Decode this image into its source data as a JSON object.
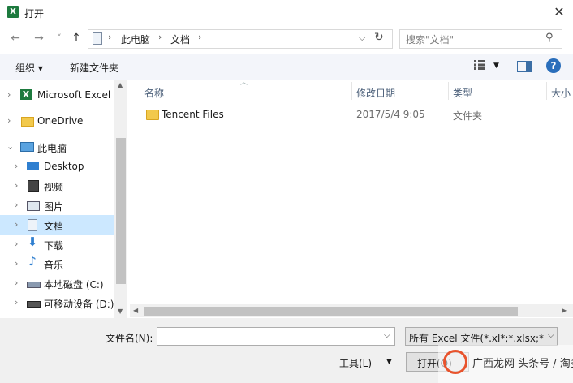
{
  "window": {
    "title": "打开",
    "app_icon": "excel-icon",
    "close_glyph": "✕"
  },
  "nav": {
    "back_glyph": "←",
    "forward_glyph": "→",
    "recent_glyph": "˅",
    "up_glyph": "↑",
    "breadcrumb": [
      "此电脑",
      "文档"
    ],
    "search_placeholder": "搜索\"文档\""
  },
  "toolbar": {
    "organize": "组织 ▾",
    "new_folder": "新建文件夹",
    "help": "?"
  },
  "tree": [
    {
      "label": "Microsoft Excel",
      "icon": "excel-icon",
      "chev": "›"
    },
    {
      "label": "OneDrive",
      "icon": "folder-icon",
      "chev": "›"
    },
    {
      "label": "此电脑",
      "icon": "computer-icon",
      "chev": "⌄"
    },
    {
      "label": "Desktop",
      "icon": "desktop-icon",
      "chev": "›"
    },
    {
      "label": "视频",
      "icon": "video-icon",
      "chev": "›"
    },
    {
      "label": "图片",
      "icon": "pictures-icon",
      "chev": "›"
    },
    {
      "label": "文档",
      "icon": "documents-icon",
      "chev": "›",
      "selected": true
    },
    {
      "label": "下载",
      "icon": "download-icon",
      "chev": "›"
    },
    {
      "label": "音乐",
      "icon": "music-icon",
      "chev": "›"
    },
    {
      "label": "本地磁盘 (C:)",
      "icon": "drive-icon",
      "chev": "›"
    },
    {
      "label": "可移动设备 (D:)",
      "icon": "removable-drive-icon",
      "chev": "›"
    }
  ],
  "columns": [
    "名称",
    "修改日期",
    "类型",
    "大小"
  ],
  "files": [
    {
      "name": "Tencent Files",
      "modified": "2017/5/4 9:05",
      "type": "文件夹"
    }
  ],
  "bottom": {
    "filename_label": "文件名(N):",
    "filename_value": "",
    "filter_value": "所有 Excel 文件(*.xl*;*.xlsx;*.xl",
    "tools": "工具(L)",
    "open": "打开(O)"
  },
  "watermark": "广西龙网 头条号 / 淘多折"
}
